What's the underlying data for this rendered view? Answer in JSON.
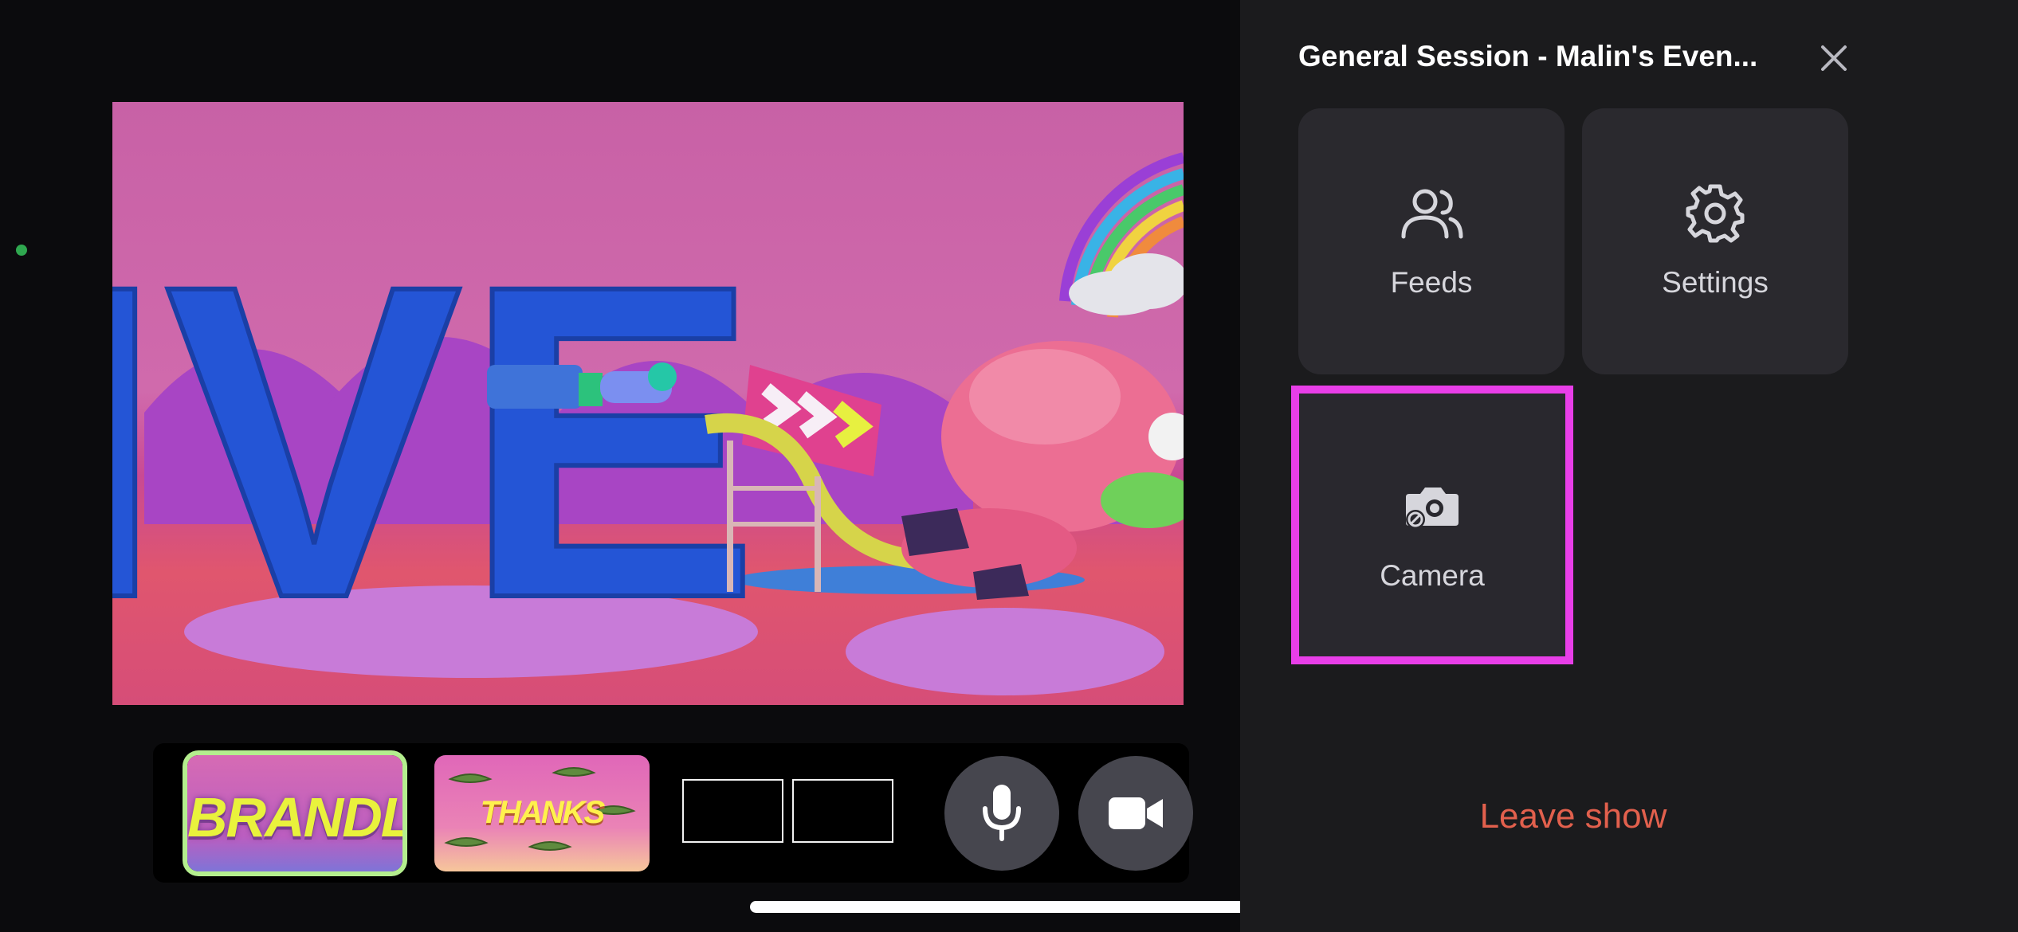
{
  "session": {
    "title": "General Session - Malin's Even..."
  },
  "menu": {
    "feeds_label": "Feeds",
    "settings_label": "Settings",
    "camera_label": "Camera",
    "leave_label": "Leave show"
  },
  "scenes": {
    "thumbnails": [
      {
        "label": "BRANDLIVE",
        "selected": true
      },
      {
        "label": "THANKS",
        "selected": false
      }
    ]
  },
  "video": {
    "sign_text": "IVE"
  },
  "colors": {
    "highlight": "#e83ee8",
    "selected_scene": "#b4ee8e",
    "leave_text": "#e2604d",
    "status_dot": "#2fa84f"
  },
  "icons": {
    "close": "close-icon",
    "feeds": "users-icon",
    "settings": "gear-icon",
    "camera": "camera-switch-icon",
    "mic": "microphone-icon",
    "video": "video-camera-icon"
  }
}
